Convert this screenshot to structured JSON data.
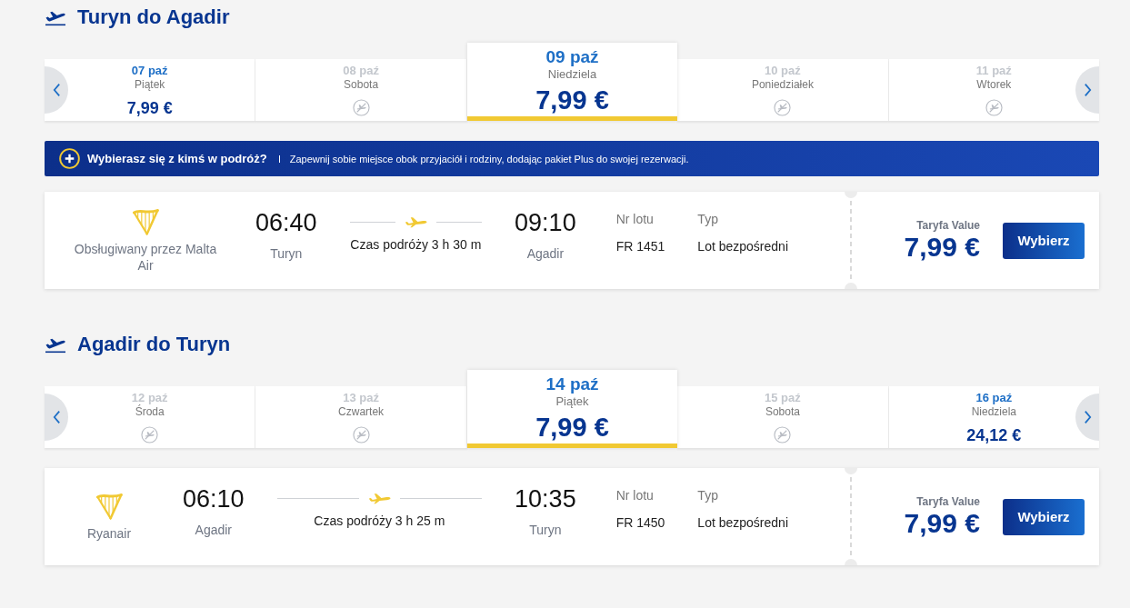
{
  "sections": [
    {
      "title": "Turyn do Agadir",
      "dates": [
        {
          "date": "07 paź",
          "day": "Piątek",
          "price": "7,99 €",
          "available": true,
          "selected": false
        },
        {
          "date": "08 paź",
          "day": "Sobota",
          "available": false,
          "selected": false
        },
        {
          "date": "09 paź",
          "day": "Niedziela",
          "price": "7,99 €",
          "available": true,
          "selected": true
        },
        {
          "date": "10 paź",
          "day": "Poniedziałek",
          "available": false,
          "selected": false
        },
        {
          "date": "11 paź",
          "day": "Wtorek",
          "available": false,
          "selected": false
        }
      ],
      "banner": {
        "title": "Wybierasz się z kimś w podróż?",
        "text": "Zapewnij sobie miejsce obok przyjaciół i rodziny, dodając pakiet Plus do swojej rezerwacji."
      },
      "flights": [
        {
          "airline": "Obsługiwany przez Malta Air",
          "departure": {
            "time": "06:40",
            "city": "Turyn"
          },
          "duration": "Czas podróży 3 h 30 m",
          "arrival": {
            "time": "09:10",
            "city": "Agadir"
          },
          "flight_no_label": "Nr lotu",
          "flight_no": "FR 1451",
          "type_label": "Typ",
          "type": "Lot bezpośredni",
          "fare_label": "Taryfa Value",
          "price": "7,99 €",
          "button": "Wybierz"
        }
      ]
    },
    {
      "title": "Agadir do Turyn",
      "dates": [
        {
          "date": "12 paź",
          "day": "Środa",
          "available": false,
          "selected": false
        },
        {
          "date": "13 paź",
          "day": "Czwartek",
          "available": false,
          "selected": false
        },
        {
          "date": "14 paź",
          "day": "Piątek",
          "price": "7,99 €",
          "available": true,
          "selected": true
        },
        {
          "date": "15 paź",
          "day": "Sobota",
          "available": false,
          "selected": false
        },
        {
          "date": "16 paź",
          "day": "Niedziela",
          "price": "24,12 €",
          "available": true,
          "selected": false
        }
      ],
      "flights": [
        {
          "airline": "Ryanair",
          "departure": {
            "time": "06:10",
            "city": "Agadir"
          },
          "duration": "Czas podróży 3 h 25 m",
          "arrival": {
            "time": "10:35",
            "city": "Turyn"
          },
          "flight_no_label": "Nr lotu",
          "flight_no": "FR 1450",
          "type_label": "Typ",
          "type": "Lot bezpośredni",
          "fare_label": "Taryfa Value",
          "price": "7,99 €",
          "button": "Wybierz"
        }
      ]
    }
  ]
}
